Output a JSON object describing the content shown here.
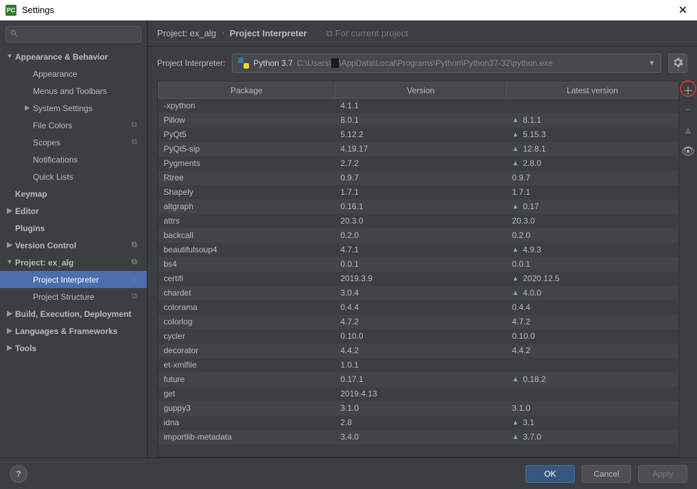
{
  "window": {
    "title": "Settings",
    "app_icon_text": "PC"
  },
  "sidebar": {
    "search_placeholder": "",
    "items": [
      {
        "label": "Appearance & Behavior",
        "level": 0,
        "bold": true,
        "arrow": "▼"
      },
      {
        "label": "Appearance",
        "level": 1
      },
      {
        "label": "Menus and Toolbars",
        "level": 1
      },
      {
        "label": "System Settings",
        "level": 1,
        "arrow": "▶"
      },
      {
        "label": "File Colors",
        "level": 1,
        "copy": true
      },
      {
        "label": "Scopes",
        "level": 1,
        "copy": true
      },
      {
        "label": "Notifications",
        "level": 1
      },
      {
        "label": "Quick Lists",
        "level": 1
      },
      {
        "label": "Keymap",
        "level": 0,
        "bold": true
      },
      {
        "label": "Editor",
        "level": 0,
        "bold": true,
        "arrow": "▶"
      },
      {
        "label": "Plugins",
        "level": 0,
        "bold": true
      },
      {
        "label": "Version Control",
        "level": 0,
        "bold": true,
        "arrow": "▶",
        "copy": true
      },
      {
        "label": "Project: ex_alg",
        "level": 0,
        "bold": true,
        "arrow": "▼",
        "copy": true
      },
      {
        "label": "Project Interpreter",
        "level": 1,
        "copy": true,
        "selected": true
      },
      {
        "label": "Project Structure",
        "level": 1,
        "copy": true
      },
      {
        "label": "Build, Execution, Deployment",
        "level": 0,
        "bold": true,
        "arrow": "▶"
      },
      {
        "label": "Languages & Frameworks",
        "level": 0,
        "bold": true,
        "arrow": "▶"
      },
      {
        "label": "Tools",
        "level": 0,
        "bold": true,
        "arrow": "▶"
      }
    ]
  },
  "breadcrumb": {
    "crumb1": "Project: ex_alg",
    "sep": "›",
    "crumb2": "Project Interpreter",
    "hint": "For current project"
  },
  "interpreter": {
    "label": "Project Interpreter:",
    "name": "Python 3.7",
    "path_pre": "C:\\Users\\",
    "path_hidden": "      ",
    "path_post": "\\AppData\\Local\\Programs\\Python\\Python37-32\\python.exe"
  },
  "table": {
    "headers": {
      "package": "Package",
      "version": "Version",
      "latest": "Latest version"
    },
    "rows": [
      {
        "pkg": "-xpython",
        "ver": "4.1.1",
        "latest": ""
      },
      {
        "pkg": "Pillow",
        "ver": "8.0.1",
        "latest": "8.1.1",
        "up": true
      },
      {
        "pkg": "PyQt5",
        "ver": "5.12.2",
        "latest": "5.15.3",
        "up": true
      },
      {
        "pkg": "PyQt5-sip",
        "ver": "4.19.17",
        "latest": "12.8.1",
        "up": true
      },
      {
        "pkg": "Pygments",
        "ver": "2.7.2",
        "latest": "2.8.0",
        "up": true
      },
      {
        "pkg": "Rtree",
        "ver": "0.9.7",
        "latest": "0.9.7"
      },
      {
        "pkg": "Shapely",
        "ver": "1.7.1",
        "latest": "1.7.1"
      },
      {
        "pkg": "altgraph",
        "ver": "0.16.1",
        "latest": "0.17",
        "up": true
      },
      {
        "pkg": "attrs",
        "ver": "20.3.0",
        "latest": "20.3.0"
      },
      {
        "pkg": "backcall",
        "ver": "0.2.0",
        "latest": "0.2.0"
      },
      {
        "pkg": "beautifulsoup4",
        "ver": "4.7.1",
        "latest": "4.9.3",
        "up": true
      },
      {
        "pkg": "bs4",
        "ver": "0.0.1",
        "latest": "0.0.1"
      },
      {
        "pkg": "certifi",
        "ver": "2019.3.9",
        "latest": "2020.12.5",
        "up": true
      },
      {
        "pkg": "chardet",
        "ver": "3.0.4",
        "latest": "4.0.0",
        "up": true
      },
      {
        "pkg": "colorama",
        "ver": "0.4.4",
        "latest": "0.4.4"
      },
      {
        "pkg": "colorlog",
        "ver": "4.7.2",
        "latest": "4.7.2"
      },
      {
        "pkg": "cycler",
        "ver": "0.10.0",
        "latest": "0.10.0"
      },
      {
        "pkg": "decorator",
        "ver": "4.4.2",
        "latest": "4.4.2"
      },
      {
        "pkg": "et-xmlfile",
        "ver": "1.0.1",
        "latest": ""
      },
      {
        "pkg": "future",
        "ver": "0.17.1",
        "latest": "0.18.2",
        "up": true
      },
      {
        "pkg": "get",
        "ver": "2019.4.13",
        "latest": ""
      },
      {
        "pkg": "guppy3",
        "ver": "3.1.0",
        "latest": "3.1.0"
      },
      {
        "pkg": "idna",
        "ver": "2.8",
        "latest": "3.1",
        "up": true
      },
      {
        "pkg": "importlib-metadata",
        "ver": "3.4.0",
        "latest": "3.7.0",
        "up": true
      }
    ]
  },
  "buttons": {
    "ok": "OK",
    "cancel": "Cancel",
    "apply": "Apply"
  }
}
